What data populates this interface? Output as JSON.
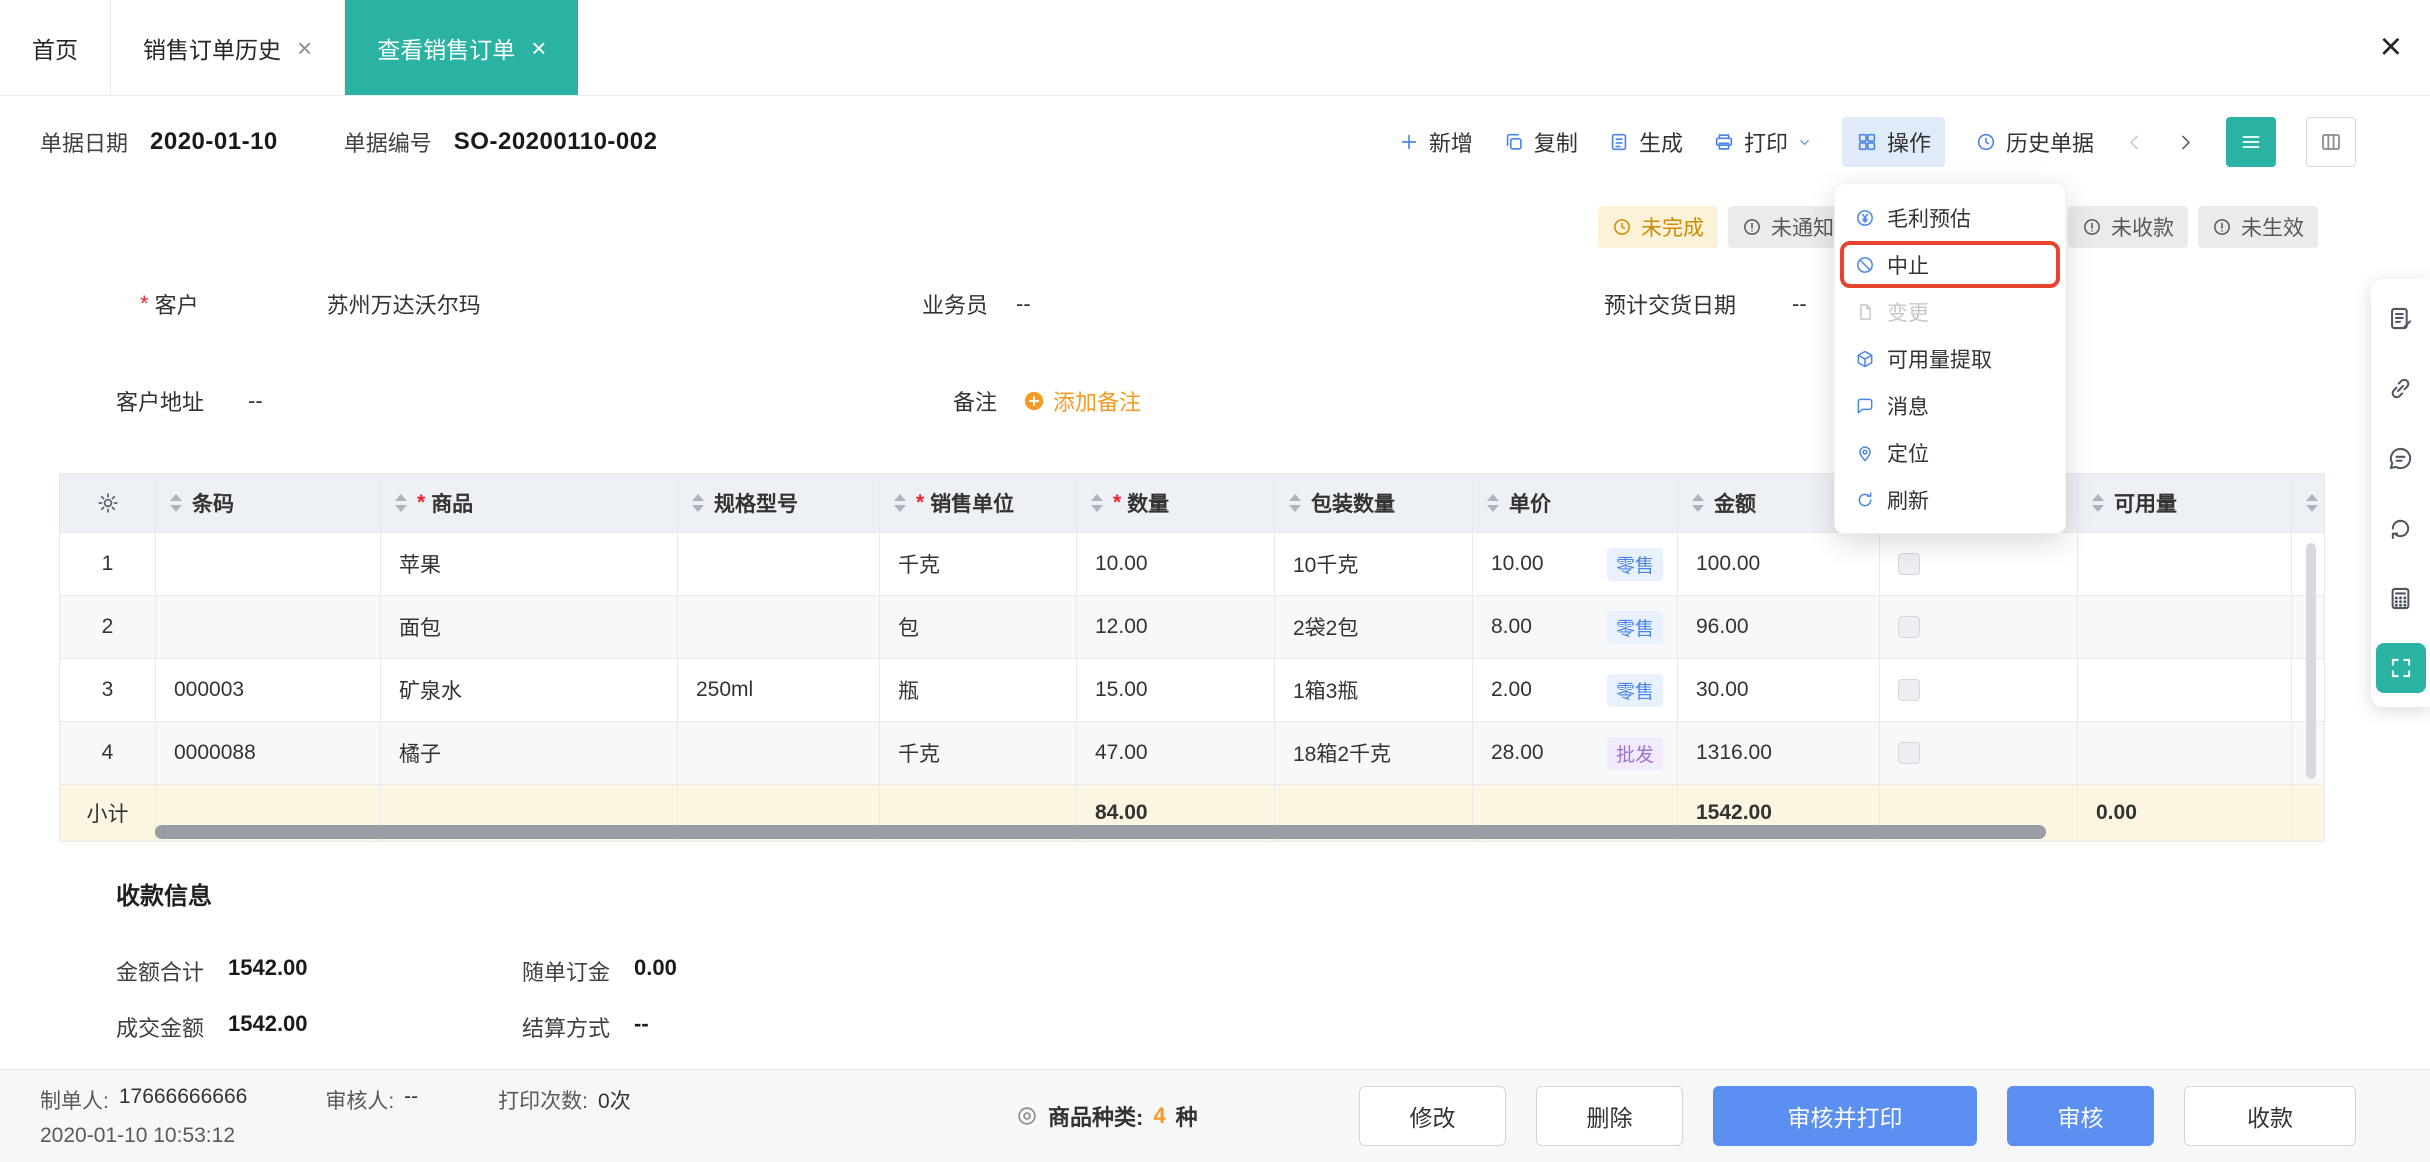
{
  "window": {
    "close_label": "×"
  },
  "colors": {
    "teal_accent": "#2ab3a3",
    "blue_icon": "#4a86e8",
    "primary_button": "#5b8ff2",
    "orange_accent": "#f59a23",
    "warning_badge_bg": "#fcf2d7",
    "warning_badge_text": "#cf8a04",
    "highlight_border": "#e8432e",
    "retail_tag": "#4a86e8",
    "wholesale_tag": "#9b72d6",
    "subtotal_row_bg": "#fbf5e1"
  },
  "tabs": {
    "items": [
      {
        "label": "首页",
        "closable": false,
        "active": false
      },
      {
        "label": "销售订单历史",
        "closable": true,
        "active": false
      },
      {
        "label": "查看销售订单",
        "closable": true,
        "active": true
      }
    ]
  },
  "toolbar": {
    "doc_date_label": "单据日期",
    "doc_date": "2020-01-10",
    "doc_no_label": "单据编号",
    "doc_no": "SO-20200110-002",
    "actions": [
      {
        "name": "add",
        "label": "新增",
        "icon": "plus-icon"
      },
      {
        "name": "copy",
        "label": "复制",
        "icon": "copy-icon"
      },
      {
        "name": "generate",
        "label": "生成",
        "icon": "generate-icon"
      },
      {
        "name": "print",
        "label": "打印",
        "icon": "printer-icon",
        "dropdown": true
      },
      {
        "name": "operations",
        "label": "操作",
        "icon": "grid-icon",
        "active": true
      },
      {
        "name": "history-docs",
        "label": "历史单据",
        "icon": "history-icon"
      }
    ]
  },
  "badges": [
    {
      "label": "未完成",
      "type": "warning",
      "icon": "clock-icon"
    },
    {
      "label": "未通知",
      "type": "default",
      "icon": "info-icon"
    },
    {
      "label": "未收款",
      "type": "default",
      "icon": "info-icon"
    },
    {
      "label": "未生效",
      "type": "default",
      "icon": "info-icon"
    }
  ],
  "action_menu": {
    "items": [
      {
        "name": "profit-estimate",
        "label": "毛利预估",
        "icon": "yen-circle-icon"
      },
      {
        "name": "abort",
        "label": "中止",
        "icon": "ban-icon",
        "highlighted": true
      },
      {
        "name": "change",
        "label": "变更",
        "icon": "doc-icon",
        "disabled": true
      },
      {
        "name": "available-extract",
        "label": "可用量提取",
        "icon": "box-icon"
      },
      {
        "name": "message",
        "label": "消息",
        "icon": "message-icon"
      },
      {
        "name": "locate",
        "label": "定位",
        "icon": "pin-icon"
      },
      {
        "name": "refresh",
        "label": "刷新",
        "icon": "refresh-icon"
      }
    ]
  },
  "form": {
    "customer_label": "客户",
    "customer_value": "苏州万达沃尔玛",
    "salesman_label": "业务员",
    "salesman_value": "--",
    "delivery_label": "预计交货日期",
    "delivery_value": "--",
    "address_label": "客户地址",
    "address_value": "--",
    "remark_label": "备注",
    "add_remark_label": "添加备注"
  },
  "table": {
    "columns": [
      {
        "key": "barcode",
        "label": "条码"
      },
      {
        "key": "product",
        "label": "商品",
        "required": true
      },
      {
        "key": "spec",
        "label": "规格型号"
      },
      {
        "key": "unit",
        "label": "销售单位",
        "required": true
      },
      {
        "key": "qty",
        "label": "数量",
        "required": true
      },
      {
        "key": "pkg",
        "label": "包装数量"
      },
      {
        "key": "price",
        "label": "单价"
      },
      {
        "key": "amount",
        "label": "金额"
      },
      {
        "key": "check",
        "label": ""
      },
      {
        "key": "avail",
        "label": "可用量"
      }
    ],
    "rows": [
      {
        "seq": "1",
        "barcode": "",
        "product": "苹果",
        "spec": "",
        "unit": "千克",
        "qty": "10.00",
        "pkg": "10千克",
        "price": "10.00",
        "price_tag": "零售",
        "price_tag_type": "retail",
        "amount": "100.00",
        "avail": ""
      },
      {
        "seq": "2",
        "barcode": "",
        "product": "面包",
        "spec": "",
        "unit": "包",
        "qty": "12.00",
        "pkg": "2袋2包",
        "price": "8.00",
        "price_tag": "零售",
        "price_tag_type": "retail",
        "amount": "96.00",
        "avail": ""
      },
      {
        "seq": "3",
        "barcode": "000003",
        "product": "矿泉水",
        "spec": "250ml",
        "unit": "瓶",
        "qty": "15.00",
        "pkg": "1箱3瓶",
        "price": "2.00",
        "price_tag": "零售",
        "price_tag_type": "retail",
        "amount": "30.00",
        "avail": ""
      },
      {
        "seq": "4",
        "barcode": "0000088",
        "product": "橘子",
        "spec": "",
        "unit": "千克",
        "qty": "47.00",
        "pkg": "18箱2千克",
        "price": "28.00",
        "price_tag": "批发",
        "price_tag_type": "wholesale",
        "amount": "1316.00",
        "avail": ""
      }
    ],
    "subtotal": {
      "label": "小计",
      "qty": "84.00",
      "amount": "1542.00",
      "avail": "0.00"
    }
  },
  "payment": {
    "title": "收款信息",
    "fields": [
      {
        "label": "金额合计",
        "value": "1542.00"
      },
      {
        "label": "随单订金",
        "value": "0.00"
      },
      {
        "label": "成交金额",
        "value": "1542.00"
      },
      {
        "label": "结算方式",
        "value": "--"
      }
    ]
  },
  "footer": {
    "creator_label": "制单人:",
    "creator_value": "17666666666",
    "created_time": "2020-01-10 10:53:12",
    "auditor_label": "审核人:",
    "auditor_value": "--",
    "print_count_label": "打印次数:",
    "print_count_value": "0次",
    "category_label": "商品种类:",
    "category_count": "4",
    "category_unit": "种",
    "buttons": [
      {
        "name": "modify",
        "label": "修改",
        "style": "default"
      },
      {
        "name": "delete",
        "label": "删除",
        "style": "default"
      },
      {
        "name": "audit-print",
        "label": "审核并打印",
        "style": "primary"
      },
      {
        "name": "audit",
        "label": "审核",
        "style": "primary"
      },
      {
        "name": "receive-payment",
        "label": "收款",
        "style": "default"
      }
    ]
  },
  "side_toolbar": {
    "items": [
      {
        "name": "document",
        "icon": "form-icon"
      },
      {
        "name": "link",
        "icon": "link-icon"
      },
      {
        "name": "chat",
        "icon": "chat-icon"
      },
      {
        "name": "reload",
        "icon": "reload-icon"
      },
      {
        "name": "calculator",
        "icon": "calculator-icon"
      },
      {
        "name": "expand",
        "icon": "expand-icon"
      }
    ]
  }
}
